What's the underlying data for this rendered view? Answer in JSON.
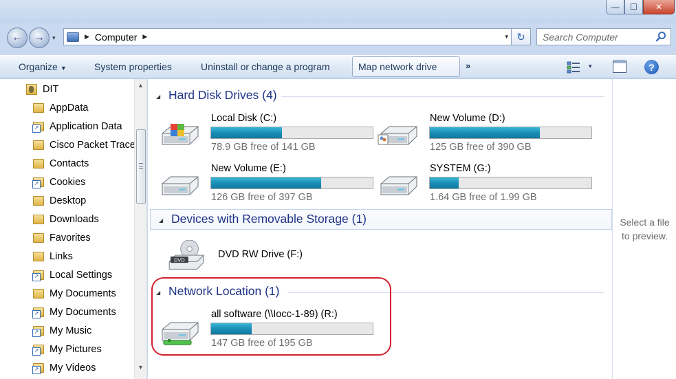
{
  "window": {
    "min_glyph": "—",
    "max_glyph": "☐",
    "close_glyph": "✕"
  },
  "nav": {
    "back_glyph": "←",
    "forward_glyph": "→",
    "dropdown_glyph": "▾"
  },
  "address": {
    "location": "Computer",
    "separator_glyph": "▶",
    "dropdown_glyph": "▾",
    "refresh_glyph": "↻"
  },
  "search": {
    "placeholder": "Search Computer"
  },
  "toolbar": {
    "organize": "Organize",
    "system_properties": "System properties",
    "uninstall": "Uninstall or change a program",
    "map_network": "Map network drive",
    "more_glyph": "»",
    "view_dropdown_glyph": "▾",
    "help_glyph": "?"
  },
  "sidebar": {
    "root": "DIT",
    "items": [
      {
        "label": "AppData",
        "link": false
      },
      {
        "label": "Application Data",
        "link": true
      },
      {
        "label": "Cisco Packet Tracer",
        "link": false
      },
      {
        "label": "Contacts",
        "link": false
      },
      {
        "label": "Cookies",
        "link": true
      },
      {
        "label": "Desktop",
        "link": false
      },
      {
        "label": "Downloads",
        "link": false
      },
      {
        "label": "Favorites",
        "link": false
      },
      {
        "label": "Links",
        "link": false
      },
      {
        "label": "Local Settings",
        "link": true
      },
      {
        "label": "My Documents",
        "link": false
      },
      {
        "label": "My Documents",
        "link": true
      },
      {
        "label": "My Music",
        "link": true
      },
      {
        "label": "My Pictures",
        "link": true
      },
      {
        "label": "My Videos",
        "link": true
      }
    ],
    "scroll_up_glyph": "▲",
    "scroll_down_glyph": "▼"
  },
  "groups": {
    "hard_disks": {
      "title": "Hard Disk Drives (4)",
      "drives": [
        {
          "name": "Local Disk (C:)",
          "free": "78.9 GB free of 141 GB",
          "used_fraction": 0.44
        },
        {
          "name": "New Volume (D:)",
          "free": "125 GB free of 390 GB",
          "used_fraction": 0.68
        },
        {
          "name": "New Volume (E:)",
          "free": "126 GB free of 397 GB",
          "used_fraction": 0.68
        },
        {
          "name": "SYSTEM (G:)",
          "free": "1.64 GB free of 1.99 GB",
          "used_fraction": 0.18
        }
      ]
    },
    "removable": {
      "title": "Devices with Removable Storage (1)",
      "drives": [
        {
          "name": "DVD RW Drive (F:)",
          "disc_label": "DVD"
        }
      ]
    },
    "network": {
      "title": "Network Location (1)",
      "drives": [
        {
          "name": "all software (\\\\Iocc-1-89) (R:)",
          "free": "147 GB free of 195 GB",
          "used_fraction": 0.25
        }
      ]
    },
    "collapse_glyph": "◢"
  },
  "preview": {
    "line1": "Select a file",
    "line2": "to preview."
  },
  "colors": {
    "group_title": "#1e3287",
    "bar_fill": "#1b8eb5",
    "highlight_ring": "#d1202e"
  }
}
